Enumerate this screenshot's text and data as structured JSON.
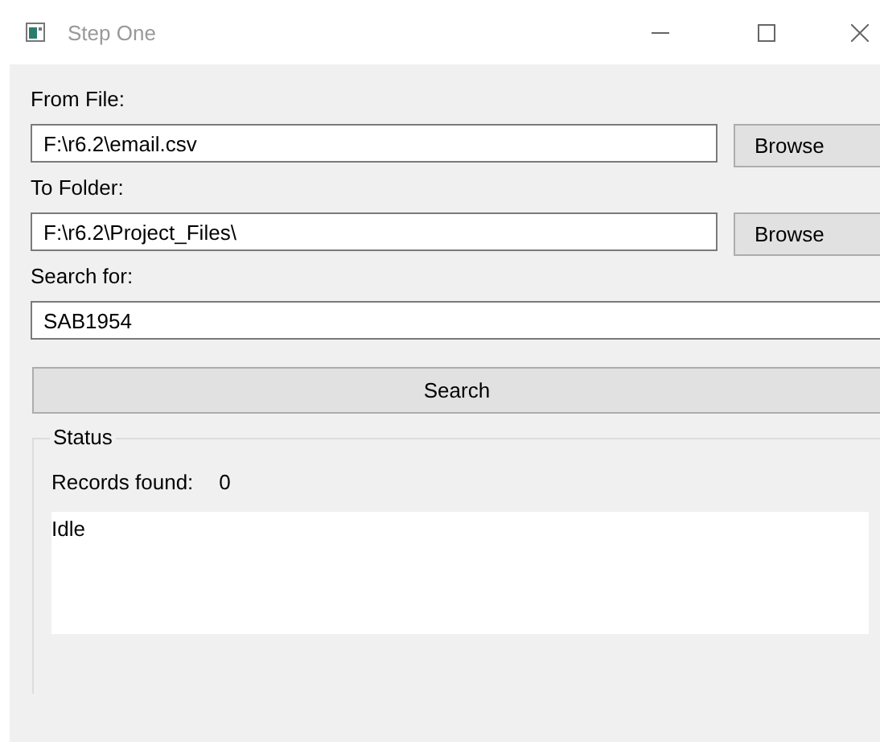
{
  "window": {
    "title": "Step One"
  },
  "from_file": {
    "label": "From File:",
    "value": "F:\\r6.2\\email.csv",
    "button": "Browse"
  },
  "to_folder": {
    "label": "To Folder:",
    "value": "F:\\r6.2\\Project_Files\\",
    "button": "Browse"
  },
  "search_for": {
    "label": "Search for:",
    "value": "SAB1954"
  },
  "search_button": "Search",
  "status": {
    "title": "Status",
    "records_label": "Records found:",
    "records_value": "0",
    "log": "Idle"
  }
}
